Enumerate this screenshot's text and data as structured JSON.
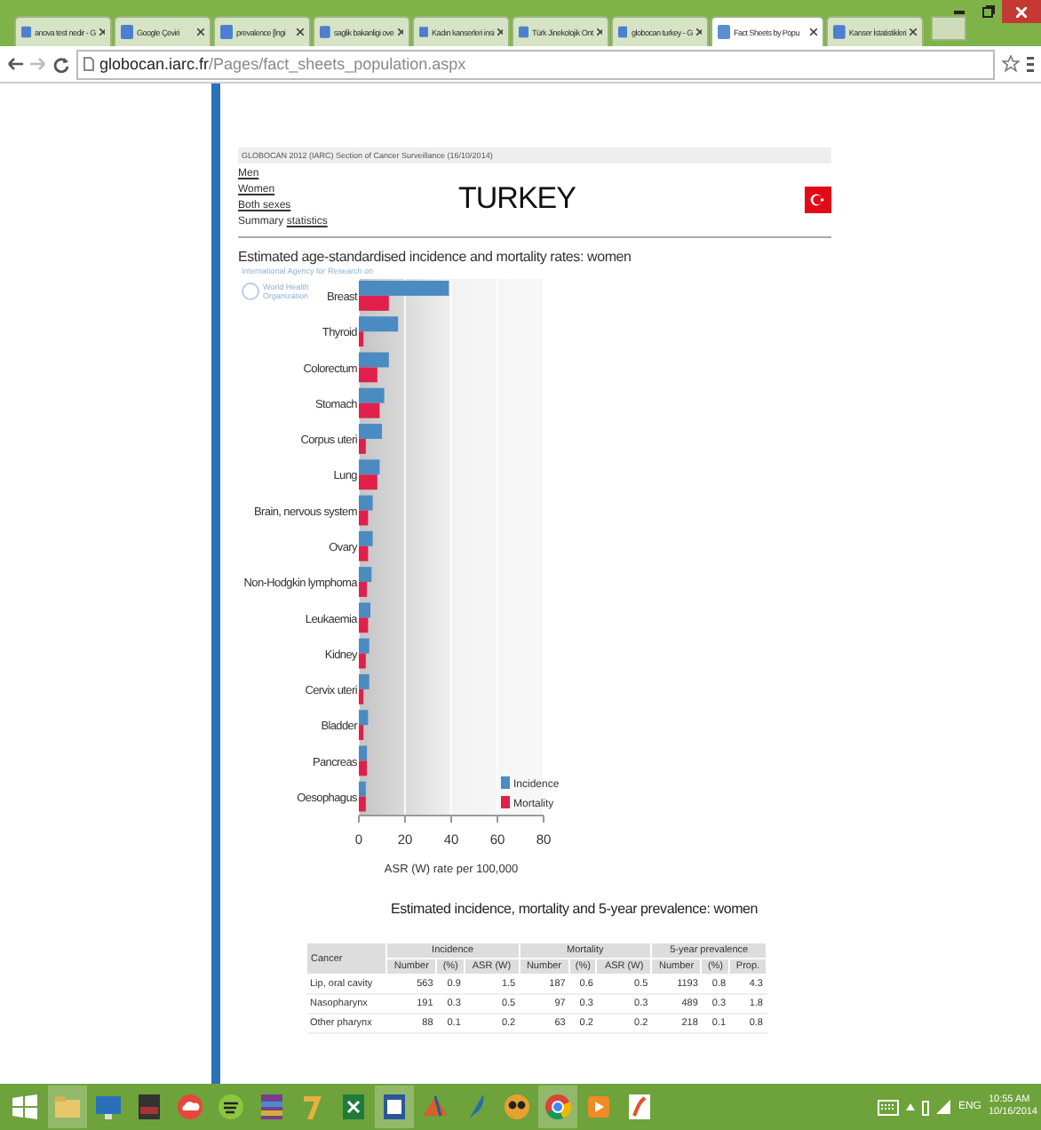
{
  "browser": {
    "tabs": [
      {
        "label": "anova test nedir - G",
        "selected": false
      },
      {
        "label": "Google Çeviri",
        "selected": false
      },
      {
        "label": "prevalence [İngi",
        "selected": false
      },
      {
        "label": "saglik bakanligi ove",
        "selected": false
      },
      {
        "label": "Kadın kanserleri insi",
        "selected": false
      },
      {
        "label": "Türk Jinekolojik Ont",
        "selected": false
      },
      {
        "label": "globocan turkey - G",
        "selected": false
      },
      {
        "label": "Fact Sheets by Popu",
        "selected": true
      },
      {
        "label": "Kanser İstatistikleri",
        "selected": false
      }
    ],
    "address": {
      "host": "globocan.iarc.fr",
      "path": "/Pages/fact_sheets_population.aspx"
    }
  },
  "page": {
    "header_strip": "GLOBOCAN 2012 (IARC) Section of Cancer Surveillance (16/10/2014)",
    "links": [
      "Men",
      "Women",
      "Both sexes"
    ],
    "summary": {
      "text": "Summary",
      "link": "statistics"
    },
    "country": "TURKEY",
    "subtitle": "Estimated age-standardised incidence and mortality rates: women",
    "logo_texts": [
      "International Agency for Research on",
      "World Health",
      "Organization"
    ],
    "chart_data": {
      "type": "bar",
      "orientation": "horizontal",
      "xlabel": "ASR (W) rate per 100,000",
      "categories": [
        "Breast",
        "Thyroid",
        "Colorectum",
        "Stomach",
        "Corpus uteri",
        "Lung",
        "Brain, nervous system",
        "Ovary",
        "Non-Hodgkin lymphoma",
        "Leukaemia",
        "Kidney",
        "Cervix uteri",
        "Bladder",
        "Pancreas",
        "Oesophagus"
      ],
      "series": [
        {
          "name": "Incidence",
          "color": "#4a8bc2",
          "values": [
            39,
            17,
            13,
            11,
            10,
            9,
            6,
            6,
            5.5,
            5,
            4.5,
            4.5,
            4,
            3.5,
            3
          ]
        },
        {
          "name": "Mortality",
          "color": "#e0204a",
          "values": [
            13,
            2,
            8,
            9,
            3,
            8,
            4,
            4,
            3.5,
            4,
            3,
            2,
            2,
            3.5,
            3
          ]
        }
      ],
      "xlim": [
        0,
        80
      ],
      "xticks": [
        0,
        20,
        40,
        60,
        80
      ],
      "grid": true,
      "legend": true
    },
    "table_title": "Estimated incidence, mortality and 5-year prevalence: women",
    "table": {
      "first_column": "Cancer",
      "groups": [
        {
          "label": "Incidence",
          "columns": [
            "Number",
            "(%)",
            "ASR (W)"
          ]
        },
        {
          "label": "Mortality",
          "columns": [
            "Number",
            "(%)",
            "ASR (W)"
          ]
        },
        {
          "label": "5-year prevalence",
          "columns": [
            "Number",
            "(%)",
            "Prop."
          ]
        }
      ],
      "rows": [
        {
          "cancer": "Lip, oral cavity",
          "cells": [
            "563",
            "0.9",
            "1.5",
            "187",
            "0.6",
            "0.5",
            "1193",
            "0.8",
            "4.3"
          ]
        },
        {
          "cancer": "Nasopharynx",
          "cells": [
            "191",
            "0.3",
            "0.5",
            "97",
            "0.3",
            "0.3",
            "489",
            "0.3",
            "1.8"
          ]
        },
        {
          "cancer": "Other pharynx",
          "cells": [
            "88",
            "0.1",
            "0.2",
            "63",
            "0.2",
            "0.2",
            "218",
            "0.1",
            "0.8"
          ]
        }
      ]
    }
  },
  "taskbar": {
    "apps": [
      {
        "kind": "folder",
        "selected": true
      },
      {
        "kind": "monitor",
        "selected": false
      },
      {
        "kind": "photo",
        "selected": false
      },
      {
        "kind": "cloud",
        "selected": false
      },
      {
        "kind": "music",
        "selected": false
      },
      {
        "kind": "archive",
        "selected": false
      },
      {
        "kind": "seven",
        "selected": false
      },
      {
        "kind": "excel",
        "selected": false
      },
      {
        "kind": "word",
        "selected": true
      },
      {
        "kind": "matlab",
        "selected": false
      },
      {
        "kind": "feather",
        "selected": false
      },
      {
        "kind": "glasses",
        "selected": false
      },
      {
        "kind": "chrome",
        "selected": true
      },
      {
        "kind": "player",
        "selected": false
      },
      {
        "kind": "pdf",
        "selected": false
      }
    ],
    "language": "ENG",
    "time": "10:55 AM",
    "date": "10/16/2014"
  }
}
